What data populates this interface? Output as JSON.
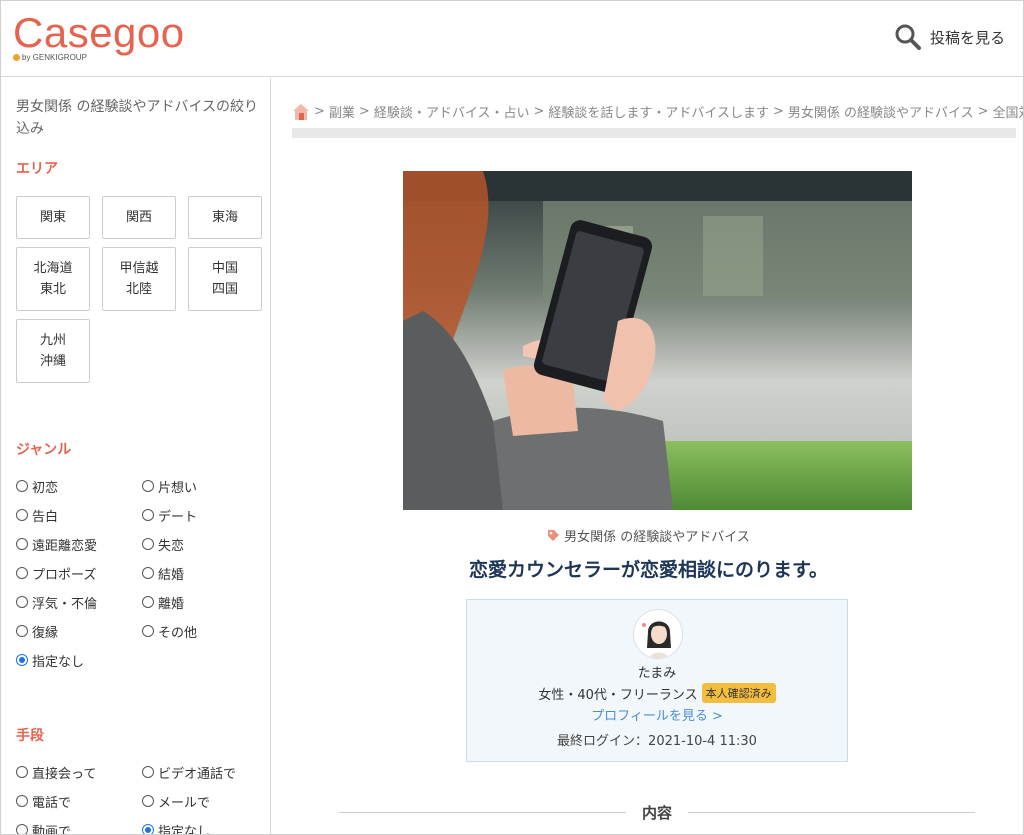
{
  "header": {
    "logo": "Casegoo",
    "logo_sub": "by GENKIGROUP",
    "post_link_label": "投稿を見る"
  },
  "sidebar": {
    "title": "男女関係 の経験談やアドバイスの絞り込み",
    "area": {
      "heading": "エリア",
      "buttons": [
        "関東",
        "関西",
        "東海",
        "北海道\n東北",
        "甲信越\n北陸",
        "中国\n四国",
        "九州\n沖縄"
      ]
    },
    "genre": {
      "heading": "ジャンル",
      "options": [
        "初恋",
        "片想い",
        "告白",
        "デート",
        "遠距離恋愛",
        "失恋",
        "プロポーズ",
        "結婚",
        "浮気・不倫",
        "離婚",
        "復縁",
        "その他",
        "指定なし"
      ],
      "selected": "指定なし"
    },
    "method": {
      "heading": "手段",
      "options": [
        "直接会って",
        "ビデオ通話で",
        "電話で",
        "メールで",
        "動画で",
        "指定なし"
      ],
      "selected": "指定なし"
    }
  },
  "main": {
    "breadcrumb": [
      "副業",
      "経験談・アドバイス・占い",
      "経験談を話します・アドバイスします",
      "男女関係 の経験談やアドバイス",
      "全国対応"
    ],
    "category_tag": "男女関係 の経験談やアドバイス",
    "post_title": "恋愛カウンセラーが恋愛相談にのります。",
    "profile": {
      "name": "たまみ",
      "info": "女性・40代・フリーランス",
      "verified_badge": "本人確認済み",
      "profile_link": "プロフィールを見る >",
      "last_login": "最終ログイン：2021-10-4 11:30"
    },
    "section_heading": "内容"
  },
  "colors": {
    "brand": "#e4644f",
    "title": "#1d3557",
    "link": "#4a8ed1",
    "badge": "#f3bd3f",
    "radio_selected": "#1a73e8"
  }
}
